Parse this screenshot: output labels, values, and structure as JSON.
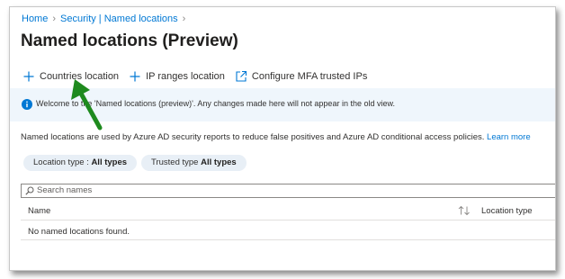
{
  "breadcrumb": {
    "home": "Home",
    "section": "Security | Named locations"
  },
  "page": {
    "title": "Named locations (Preview)"
  },
  "toolbar": {
    "countries": "Countries location",
    "ip_ranges": "IP ranges location",
    "mfa": "Configure MFA trusted IPs"
  },
  "banner": {
    "message": "Welcome to the 'Named locations (preview)'. Any changes made here will not appear in the old view."
  },
  "description": {
    "text": "Named locations are used by Azure AD security reports to reduce false positives and Azure AD conditional access policies.",
    "link": "Learn more"
  },
  "filters": {
    "location_type_label": "Location type : ",
    "location_type_value": "All types",
    "trusted_type_label": "Trusted type ",
    "trusted_type_value": "All types"
  },
  "search": {
    "placeholder": "Search names"
  },
  "table": {
    "columns": [
      "Name",
      "Location type"
    ],
    "empty_message": "No named locations found."
  },
  "icons": [
    "chevron-right-icon",
    "plus-icon",
    "external-link-icon",
    "info-icon",
    "search-icon",
    "sort-icon",
    "green-arrow-annotation"
  ],
  "colors": {
    "link": "#0078d4",
    "banner_bg": "#eff6fc",
    "arrow": "#1e8a1e"
  }
}
